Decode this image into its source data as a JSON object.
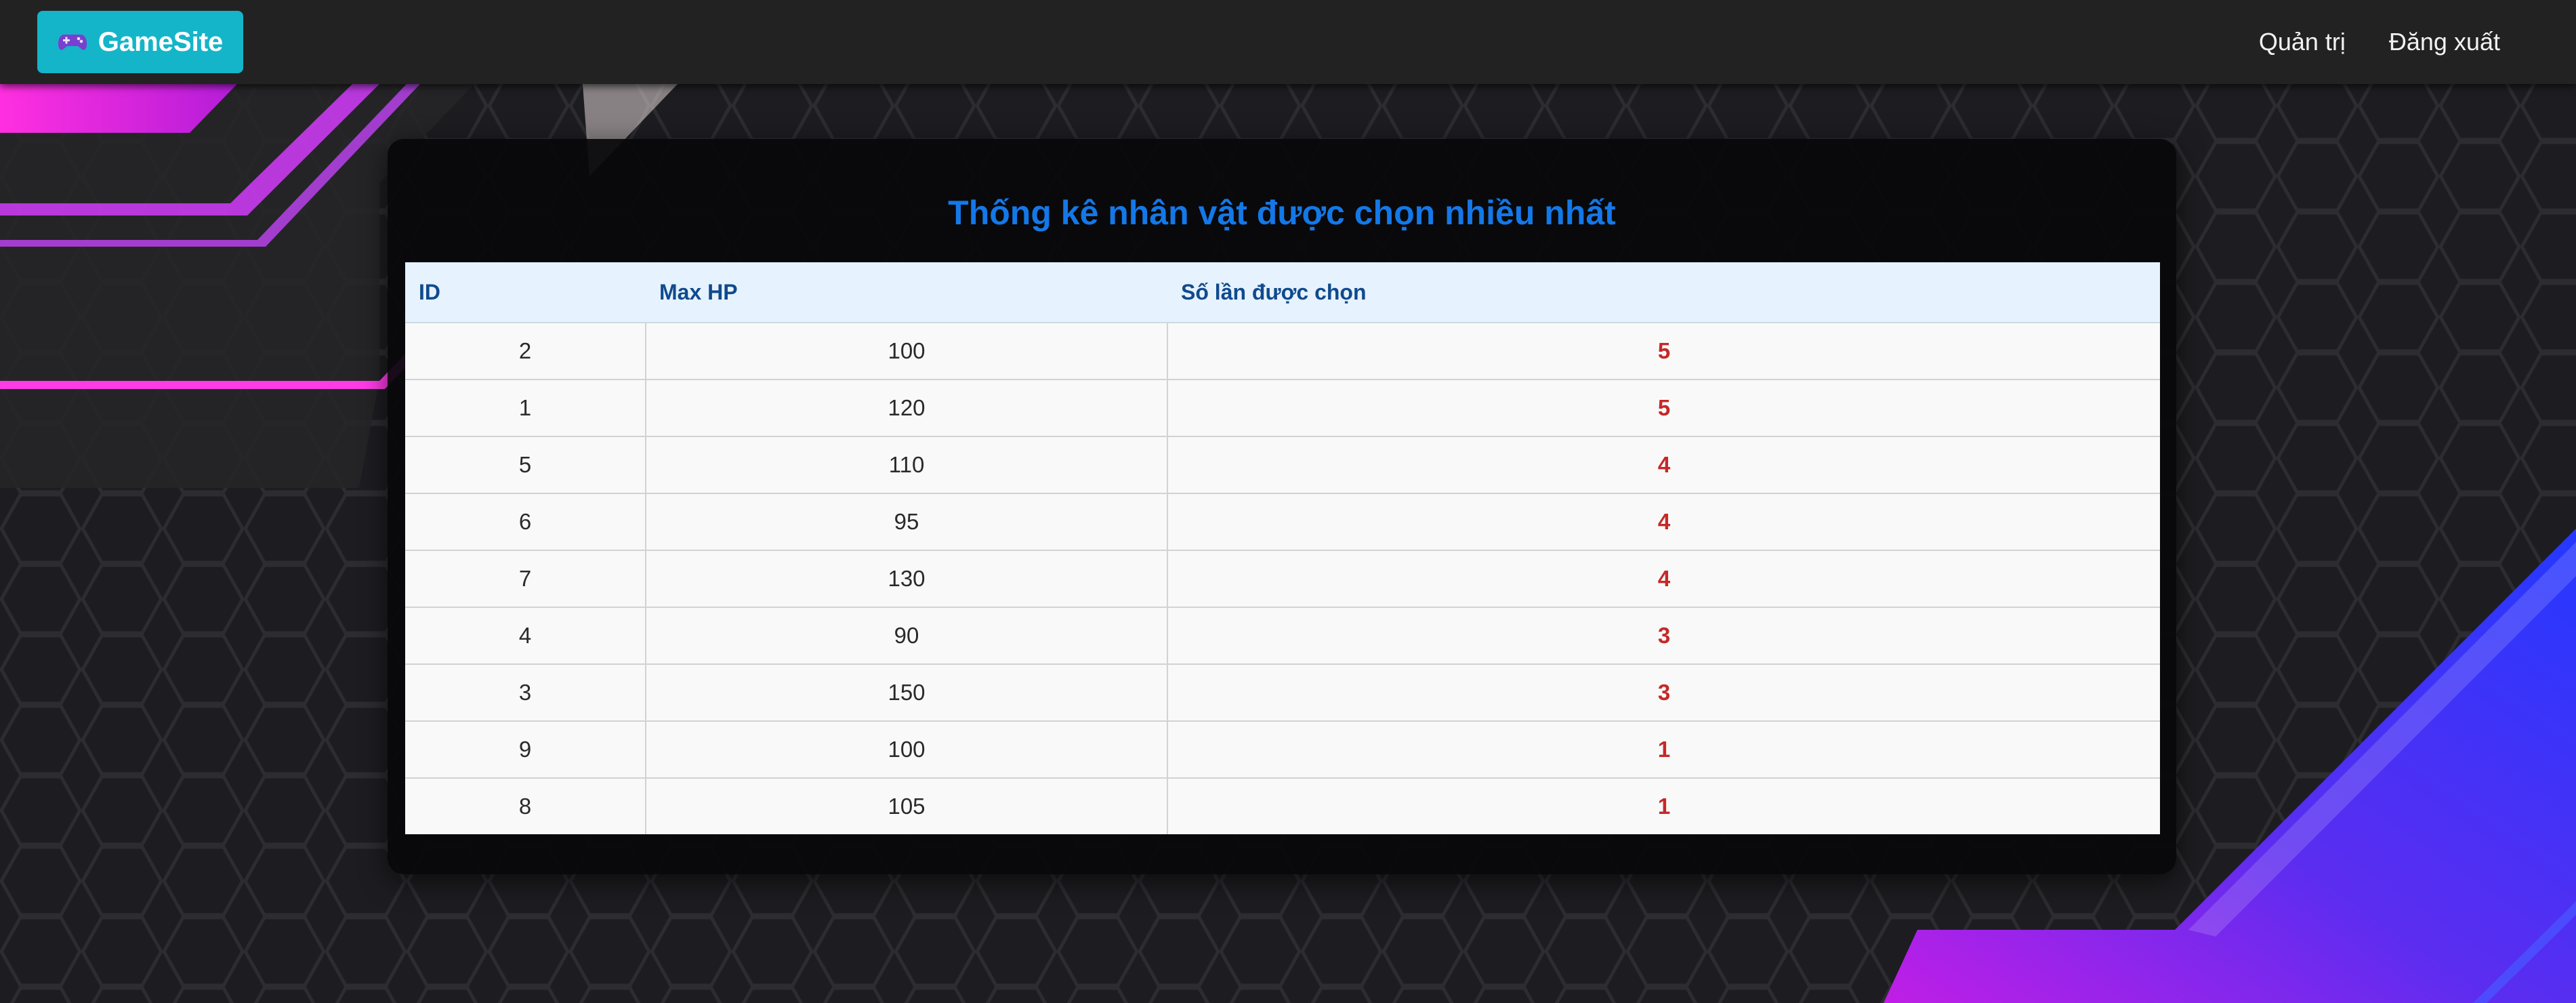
{
  "navbar": {
    "brand": "GameSite",
    "brand_icon": "gamepad-icon",
    "links": [
      {
        "label": "Quản trị"
      },
      {
        "label": "Đăng xuất"
      }
    ]
  },
  "main": {
    "title": "Thống kê nhân vật được chọn nhiều nhất",
    "table": {
      "headers": [
        "ID",
        "Max HP",
        "Số lần được chọn"
      ],
      "rows": [
        {
          "id": "2",
          "max_hp": "100",
          "count": "5"
        },
        {
          "id": "1",
          "max_hp": "120",
          "count": "5"
        },
        {
          "id": "5",
          "max_hp": "110",
          "count": "4"
        },
        {
          "id": "6",
          "max_hp": "95",
          "count": "4"
        },
        {
          "id": "7",
          "max_hp": "130",
          "count": "4"
        },
        {
          "id": "4",
          "max_hp": "90",
          "count": "3"
        },
        {
          "id": "3",
          "max_hp": "150",
          "count": "3"
        },
        {
          "id": "9",
          "max_hp": "100",
          "count": "1"
        },
        {
          "id": "8",
          "max_hp": "105",
          "count": "1"
        }
      ]
    }
  },
  "colors": {
    "brand_bg": "#14b5c9",
    "title": "#1478e8",
    "count_text": "#c62828",
    "header_bg": "#e6f2fd",
    "header_text": "#104a8e"
  }
}
